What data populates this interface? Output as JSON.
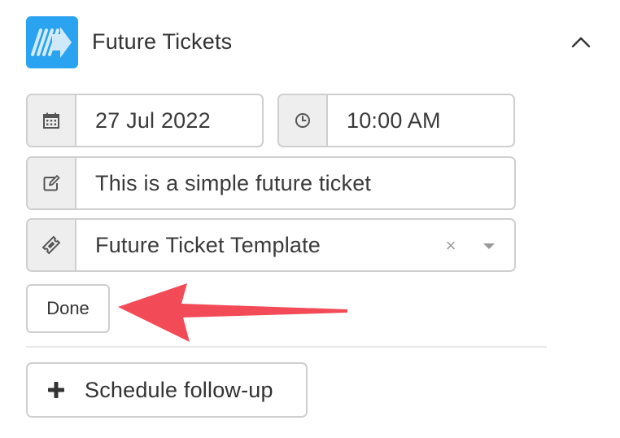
{
  "header": {
    "title": "Future Tickets",
    "logo_icon": "arrow-stripes-logo-icon",
    "collapse_icon": "chevron-up-icon",
    "accent_color": "#2aa3f0"
  },
  "form": {
    "date": {
      "icon": "calendar-icon",
      "value": "27 Jul 2022"
    },
    "time": {
      "icon": "clock-icon",
      "value": "10:00 AM"
    },
    "description": {
      "icon": "edit-icon",
      "value": "This is a simple future ticket"
    },
    "template": {
      "icon": "ticket-icon",
      "value": "Future Ticket Template",
      "clear_symbol": "×",
      "caret_icon": "caret-down-icon"
    },
    "done_label": "Done"
  },
  "annotation": {
    "icon": "red-arrow-icon",
    "color": "#f24b57"
  },
  "followup": {
    "icon": "plus-icon",
    "label": "Schedule follow-up"
  }
}
